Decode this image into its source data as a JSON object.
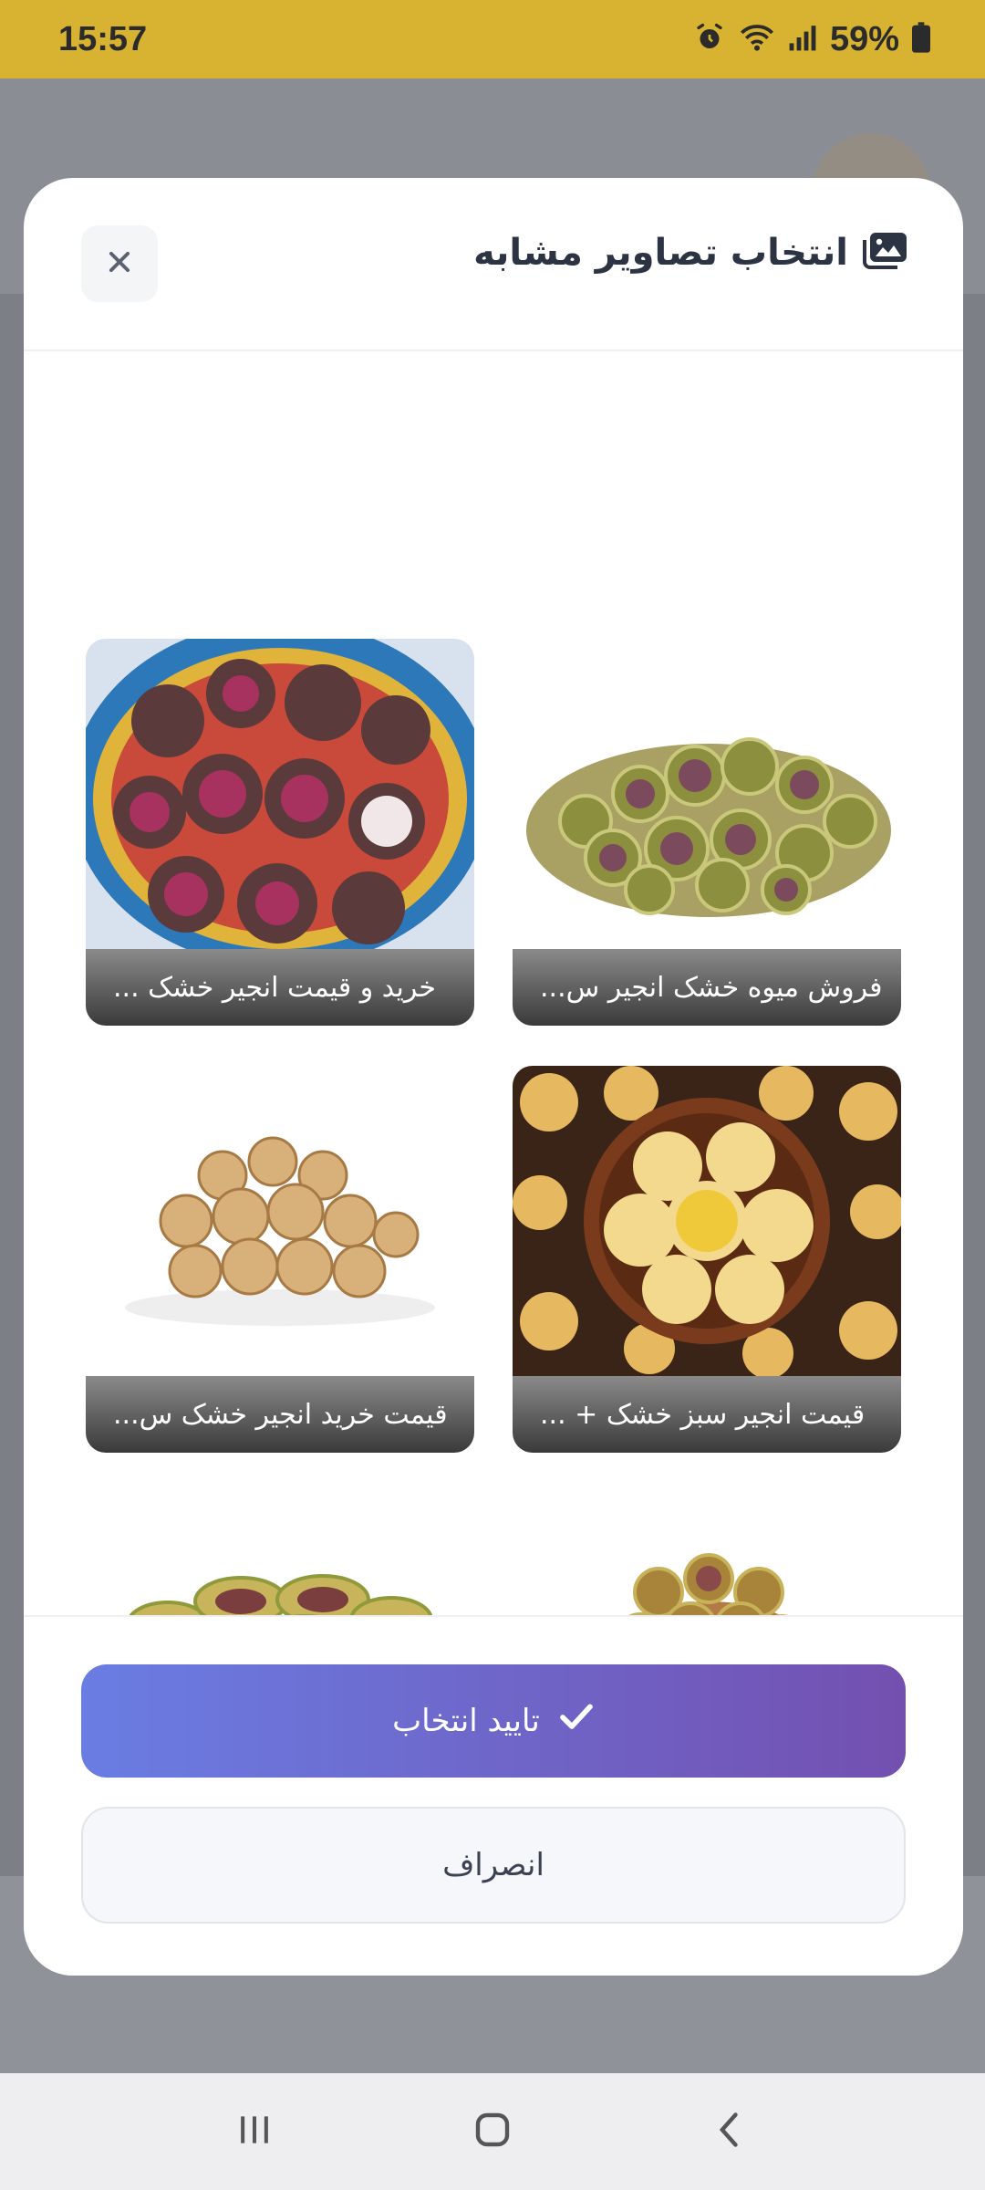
{
  "status_bar": {
    "time": "15:57",
    "battery_text": "59%"
  },
  "modal": {
    "title": "انتخاب تصاویر مشابه",
    "cards": [
      {
        "caption": "فروش میوه خشک انجیر س..."
      },
      {
        "caption": "خرید و قیمت انجیر خشک ..."
      },
      {
        "caption": "قیمت انجیر سبز خشک + ..."
      },
      {
        "caption": "قیمت خرید انجیر خشک س..."
      },
      {
        "caption": ""
      },
      {
        "caption": ""
      }
    ],
    "confirm_label": "تایید انتخاب",
    "cancel_label": "انصراف"
  },
  "colors": {
    "accent_start": "#6a7de3",
    "accent_end": "#7350b0",
    "status_bar": "#d8b331"
  }
}
